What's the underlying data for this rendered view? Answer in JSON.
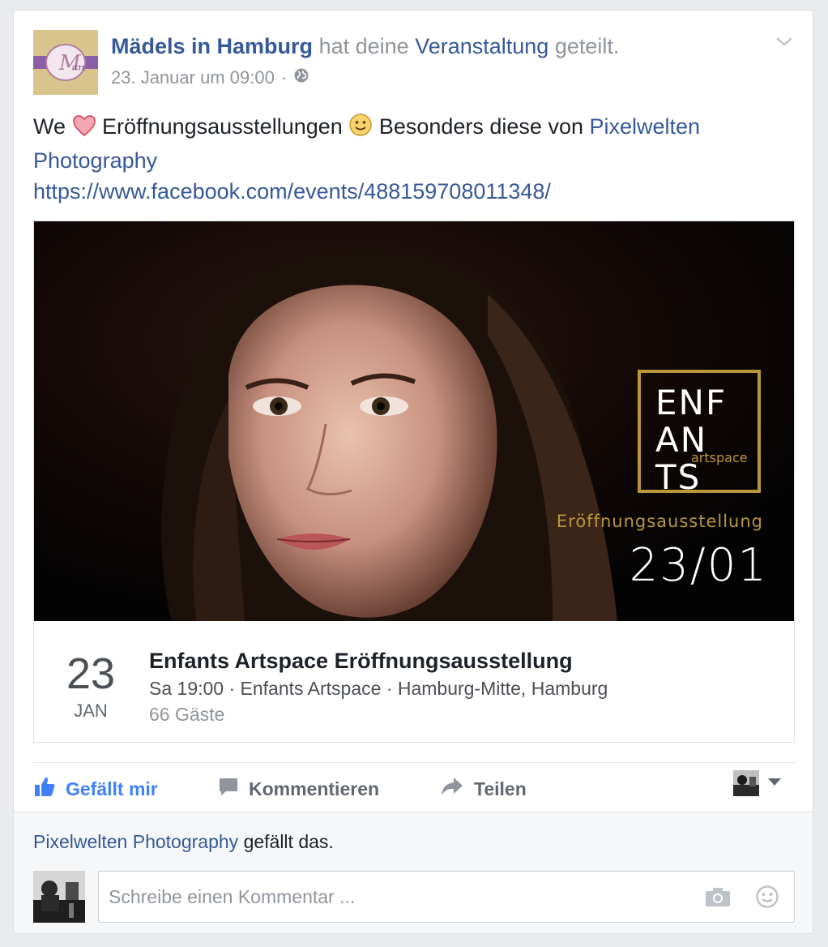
{
  "post": {
    "page_name": "Mädels in Hamburg",
    "action_text": "hat deine",
    "shared_object": "Veranstaltung",
    "suffix": "geteilt.",
    "timestamp": "23. Januar um 09:00",
    "separator": "·",
    "text_before_heart": "We",
    "text_after_heart": "Eröffnungsausstellungen",
    "text_after_smile": "Besonders diese von",
    "mention": "Pixelwelten Photography",
    "url": "https://www.facebook.com/events/488159708011348/"
  },
  "event": {
    "cover_logo_lines": [
      "ENF",
      "AN",
      "TS"
    ],
    "cover_logo_sub": "artspace",
    "cover_subtitle": "Eröffnungsausstellung",
    "cover_date": "23/01",
    "day": "23",
    "month": "JAN",
    "title": "Enfants Artspace Eröffnungsausstellung",
    "details": "Sa 19:00 · Enfants Artspace · Hamburg-Mitte, Hamburg",
    "guests": "66 Gäste"
  },
  "actions": {
    "like": "Gefällt mir",
    "comment": "Kommentieren",
    "share": "Teilen"
  },
  "footer": {
    "liker": "Pixelwelten Photography",
    "likes_suffix": "gefällt das.",
    "comment_placeholder": "Schreibe einen Kommentar ..."
  },
  "colors": {
    "link": "#365899",
    "like_blue": "#4080ff",
    "gold": "#b8963a",
    "heart": "#e25d6f"
  },
  "icons": [
    "chevron-down-icon",
    "globe-icon",
    "heart-icon",
    "smile-emoji-icon",
    "thumbs-up-icon",
    "comment-icon",
    "share-icon",
    "caret-down-icon",
    "camera-icon",
    "smiley-icon"
  ]
}
